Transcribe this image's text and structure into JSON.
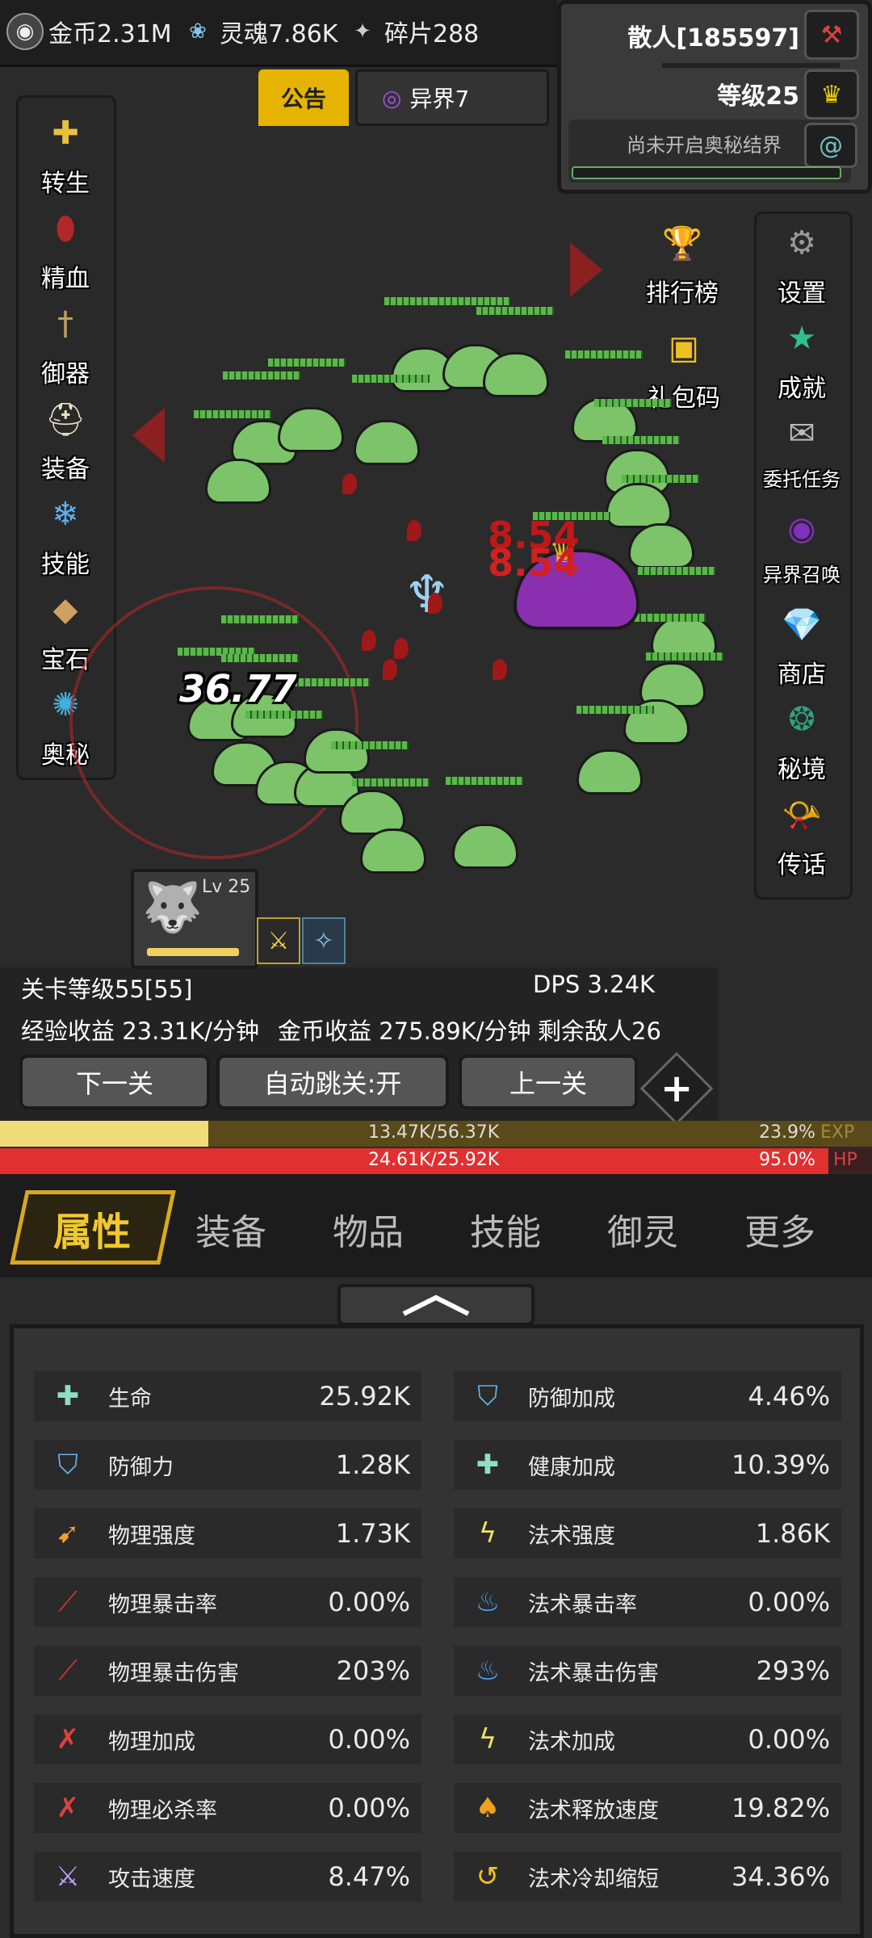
{
  "resources": [
    {
      "name": "gold-icon",
      "label": "金币2.31M",
      "color": "#d8d8d8"
    },
    {
      "name": "soul-icon",
      "label": "灵魂7.86K",
      "color": "#7ec8f0"
    },
    {
      "name": "shard-icon",
      "label": "碎片288",
      "color": "#cccccc"
    }
  ],
  "profile": {
    "name": "散人[185597]",
    "level": "等级25",
    "realm_note": "尚未开启奥秘结界"
  },
  "notice_tab": "公告",
  "world_tab": "异界7",
  "left_menu": [
    {
      "label": "转生",
      "icon": "rebirth-icon",
      "color": "#e8c040"
    },
    {
      "label": "精血",
      "icon": "blood-essence-icon",
      "color": "#b02828"
    },
    {
      "label": "御器",
      "icon": "sword-artifact-icon",
      "color": "#c0a060"
    },
    {
      "label": "装备",
      "icon": "helmet-icon",
      "color": "#e8e0c0"
    },
    {
      "label": "技能",
      "icon": "ice-skill-icon",
      "color": "#60b0f0"
    },
    {
      "label": "宝石",
      "icon": "gem-bag-icon",
      "color": "#d0a060"
    },
    {
      "label": "奥秘",
      "icon": "vortex-icon",
      "color": "#40b0e0"
    }
  ],
  "right_menu": [
    {
      "label": "设置",
      "icon": "gear-icon",
      "color": "#888888"
    },
    {
      "label": "成就",
      "icon": "star-icon",
      "color": "#30c090"
    },
    {
      "label": "委托任务",
      "icon": "scroll-icon",
      "color": "#bbbbbb"
    },
    {
      "label": "异界召唤",
      "icon": "portal-icon",
      "color": "#8030c0"
    },
    {
      "label": "商店",
      "icon": "shop-bag-icon",
      "color": "#c09050"
    },
    {
      "label": "秘境",
      "icon": "secret-realm-icon",
      "color": "#30a080"
    },
    {
      "label": "传话",
      "icon": "horn-icon",
      "color": "#30a060"
    }
  ],
  "ranking_label": "排行榜",
  "gift_code_label": "礼包码",
  "damage_numbers": [
    "8.54",
    "8.54",
    "36.77"
  ],
  "pet": {
    "level": "Lv 25"
  },
  "battle": {
    "stage": "关卡等级55[55]",
    "dps": "DPS 3.24K",
    "exp_rate": "经验收益 23.31K/分钟",
    "gold_rate": "金币收益 275.89K/分钟",
    "enemies_left": "剩余敌人26"
  },
  "buttons": {
    "next": "下一关",
    "auto": "自动跳关:开",
    "prev": "上一关"
  },
  "exp": {
    "value": "13.47K/56.37K",
    "percent": "23.9%",
    "label": "EXP",
    "fraction": 0.239
  },
  "hp": {
    "value": "24.61K/25.92K",
    "percent": "95.0%",
    "label": "HP",
    "fraction": 0.95
  },
  "tabs": [
    "属性",
    "装备",
    "物品",
    "技能",
    "御灵",
    "更多"
  ],
  "stats": [
    {
      "name": "生命",
      "value": "25.92K",
      "icon": "health-cross-icon"
    },
    {
      "name": "防御加成",
      "value": "4.46%",
      "icon": "shield-icon"
    },
    {
      "name": "防御力",
      "value": "1.28K",
      "icon": "shield-icon"
    },
    {
      "name": "健康加成",
      "value": "10.39%",
      "icon": "health-cross-icon"
    },
    {
      "name": "物理强度",
      "value": "1.73K",
      "icon": "claw-icon"
    },
    {
      "name": "法术强度",
      "value": "1.86K",
      "icon": "lightning-icon"
    },
    {
      "name": "物理暴击率",
      "value": "0.00%",
      "icon": "slash-icon"
    },
    {
      "name": "法术暴击率",
      "value": "0.00%",
      "icon": "blue-flame-icon"
    },
    {
      "name": "物理暴击伤害",
      "value": "203%",
      "icon": "slash-icon"
    },
    {
      "name": "法术暴击伤害",
      "value": "293%",
      "icon": "blue-flame-icon"
    },
    {
      "name": "物理加成",
      "value": "0.00%",
      "icon": "blood-slash-icon"
    },
    {
      "name": "法术加成",
      "value": "0.00%",
      "icon": "lightning-icon"
    },
    {
      "name": "物理必杀率",
      "value": "0.00%",
      "icon": "blood-slash-icon"
    },
    {
      "name": "法术释放速度",
      "value": "19.82%",
      "icon": "fire-crest-icon"
    },
    {
      "name": "攻击速度",
      "value": "8.47%",
      "icon": "crossed-swords-icon"
    },
    {
      "name": "法术冷却缩短",
      "value": "34.36%",
      "icon": "cooldown-arrow-icon"
    }
  ]
}
